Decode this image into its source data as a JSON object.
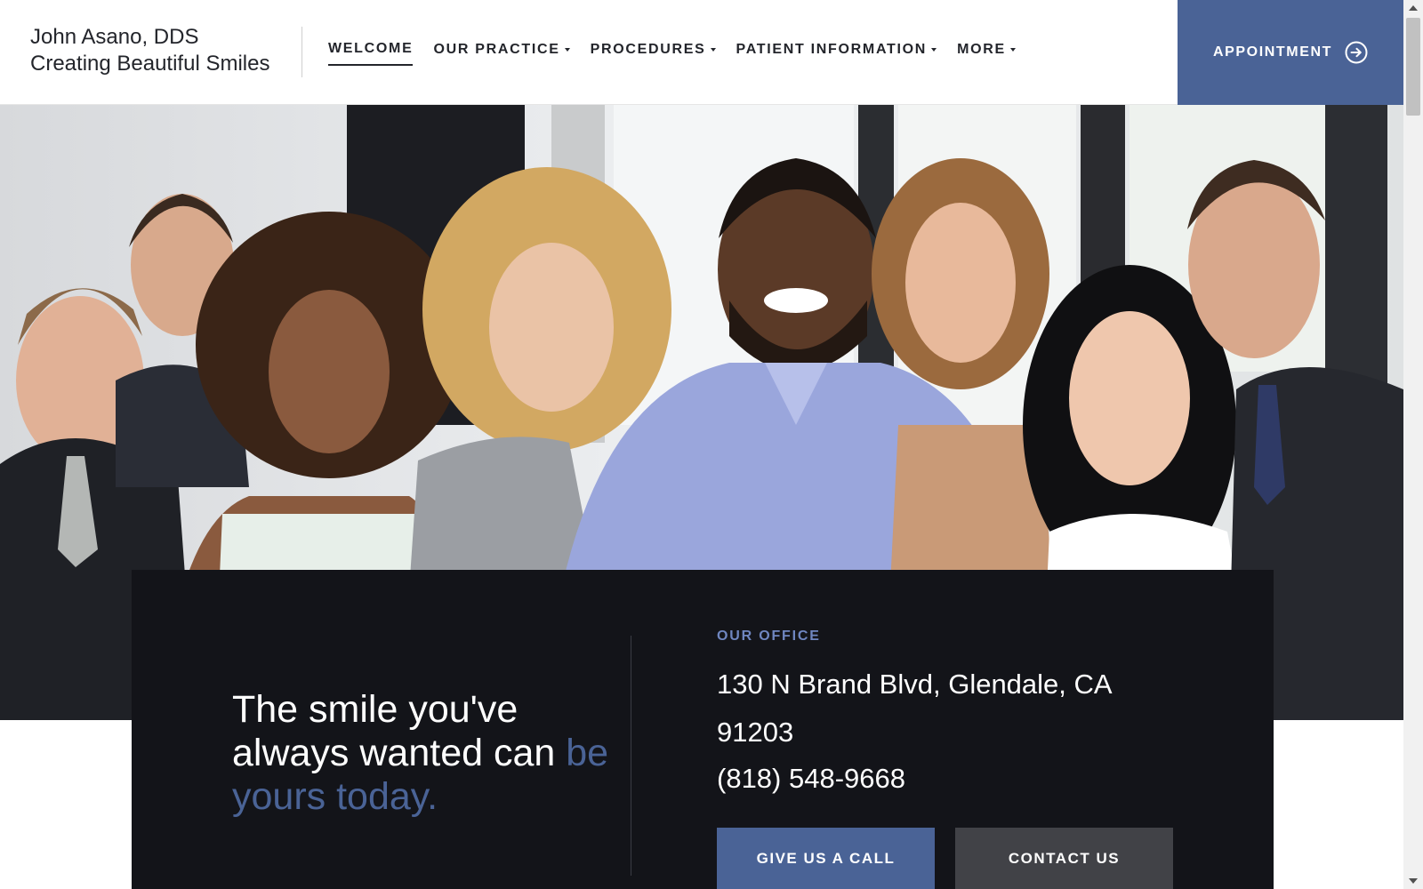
{
  "brand": {
    "name": "John Asano, DDS",
    "tagline": "Creating Beautiful Smiles"
  },
  "nav": {
    "items": [
      {
        "label": "WELCOME",
        "active": true,
        "dropdown": false
      },
      {
        "label": "OUR PRACTICE",
        "active": false,
        "dropdown": true
      },
      {
        "label": "PROCEDURES",
        "active": false,
        "dropdown": true
      },
      {
        "label": "PATIENT INFORMATION",
        "active": false,
        "dropdown": true
      },
      {
        "label": "MORE",
        "active": false,
        "dropdown": true
      }
    ]
  },
  "appointment": {
    "label": "APPOINTMENT",
    "icon": "arrow-right-circle-icon"
  },
  "hero": {
    "image": "group-of-smiling-people-photo"
  },
  "panel": {
    "tagline_main": "The smile you've always wanted can ",
    "tagline_accent": "be yours today.",
    "office_label": "OUR OFFICE",
    "address": "130 N Brand Blvd, Glendale, CA 91203",
    "phone": "(818) 548-9668",
    "call_button": "GIVE US A CALL",
    "contact_button": "CONTACT US"
  },
  "colors": {
    "accent": "#4a6396",
    "panel_bg": "#131419",
    "office_label": "#6f86c0",
    "contact_button_bg": "#414247"
  }
}
